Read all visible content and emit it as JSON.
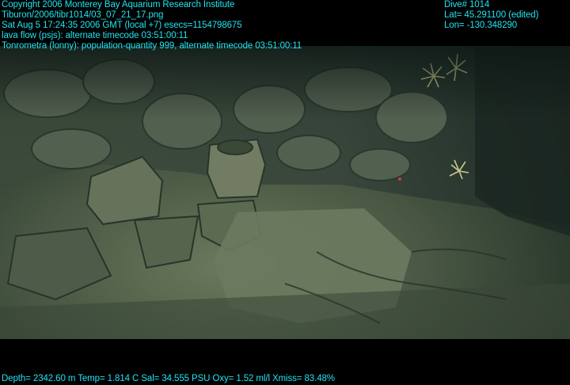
{
  "overlay": {
    "copyright": "Copyright 2006 Monterey Bay Aquarium Research Institute",
    "file_path": "Tiburon/2006/tibr1014/03_07_21_17.png",
    "datetime": "Sat Aug  5 17:24:35 2006 GMT (local +7)  esecs=1154798675",
    "lava_flow": "lava flow (psjs): alternate timecode 03:51:00:11",
    "tonrometra": "Tonrometra (lonny): population-quantity 999, alternate timecode 03:51:00:11",
    "dive": "Dive# 1014",
    "lat": "Lat= 45.291100 (edited)",
    "lon": "Lon= -130.348290",
    "sensors": "Depth= 2342.60 m  Temp= 1.814 C  Sal= 34.555 PSU  Oxy= 1.52 ml/l  Xmiss= 83.48%"
  },
  "colors": {
    "overlay_text": "#22e3f0",
    "background": "#000000",
    "scene_dark": "#1c2a22",
    "scene_light": "#6b7a5c"
  }
}
